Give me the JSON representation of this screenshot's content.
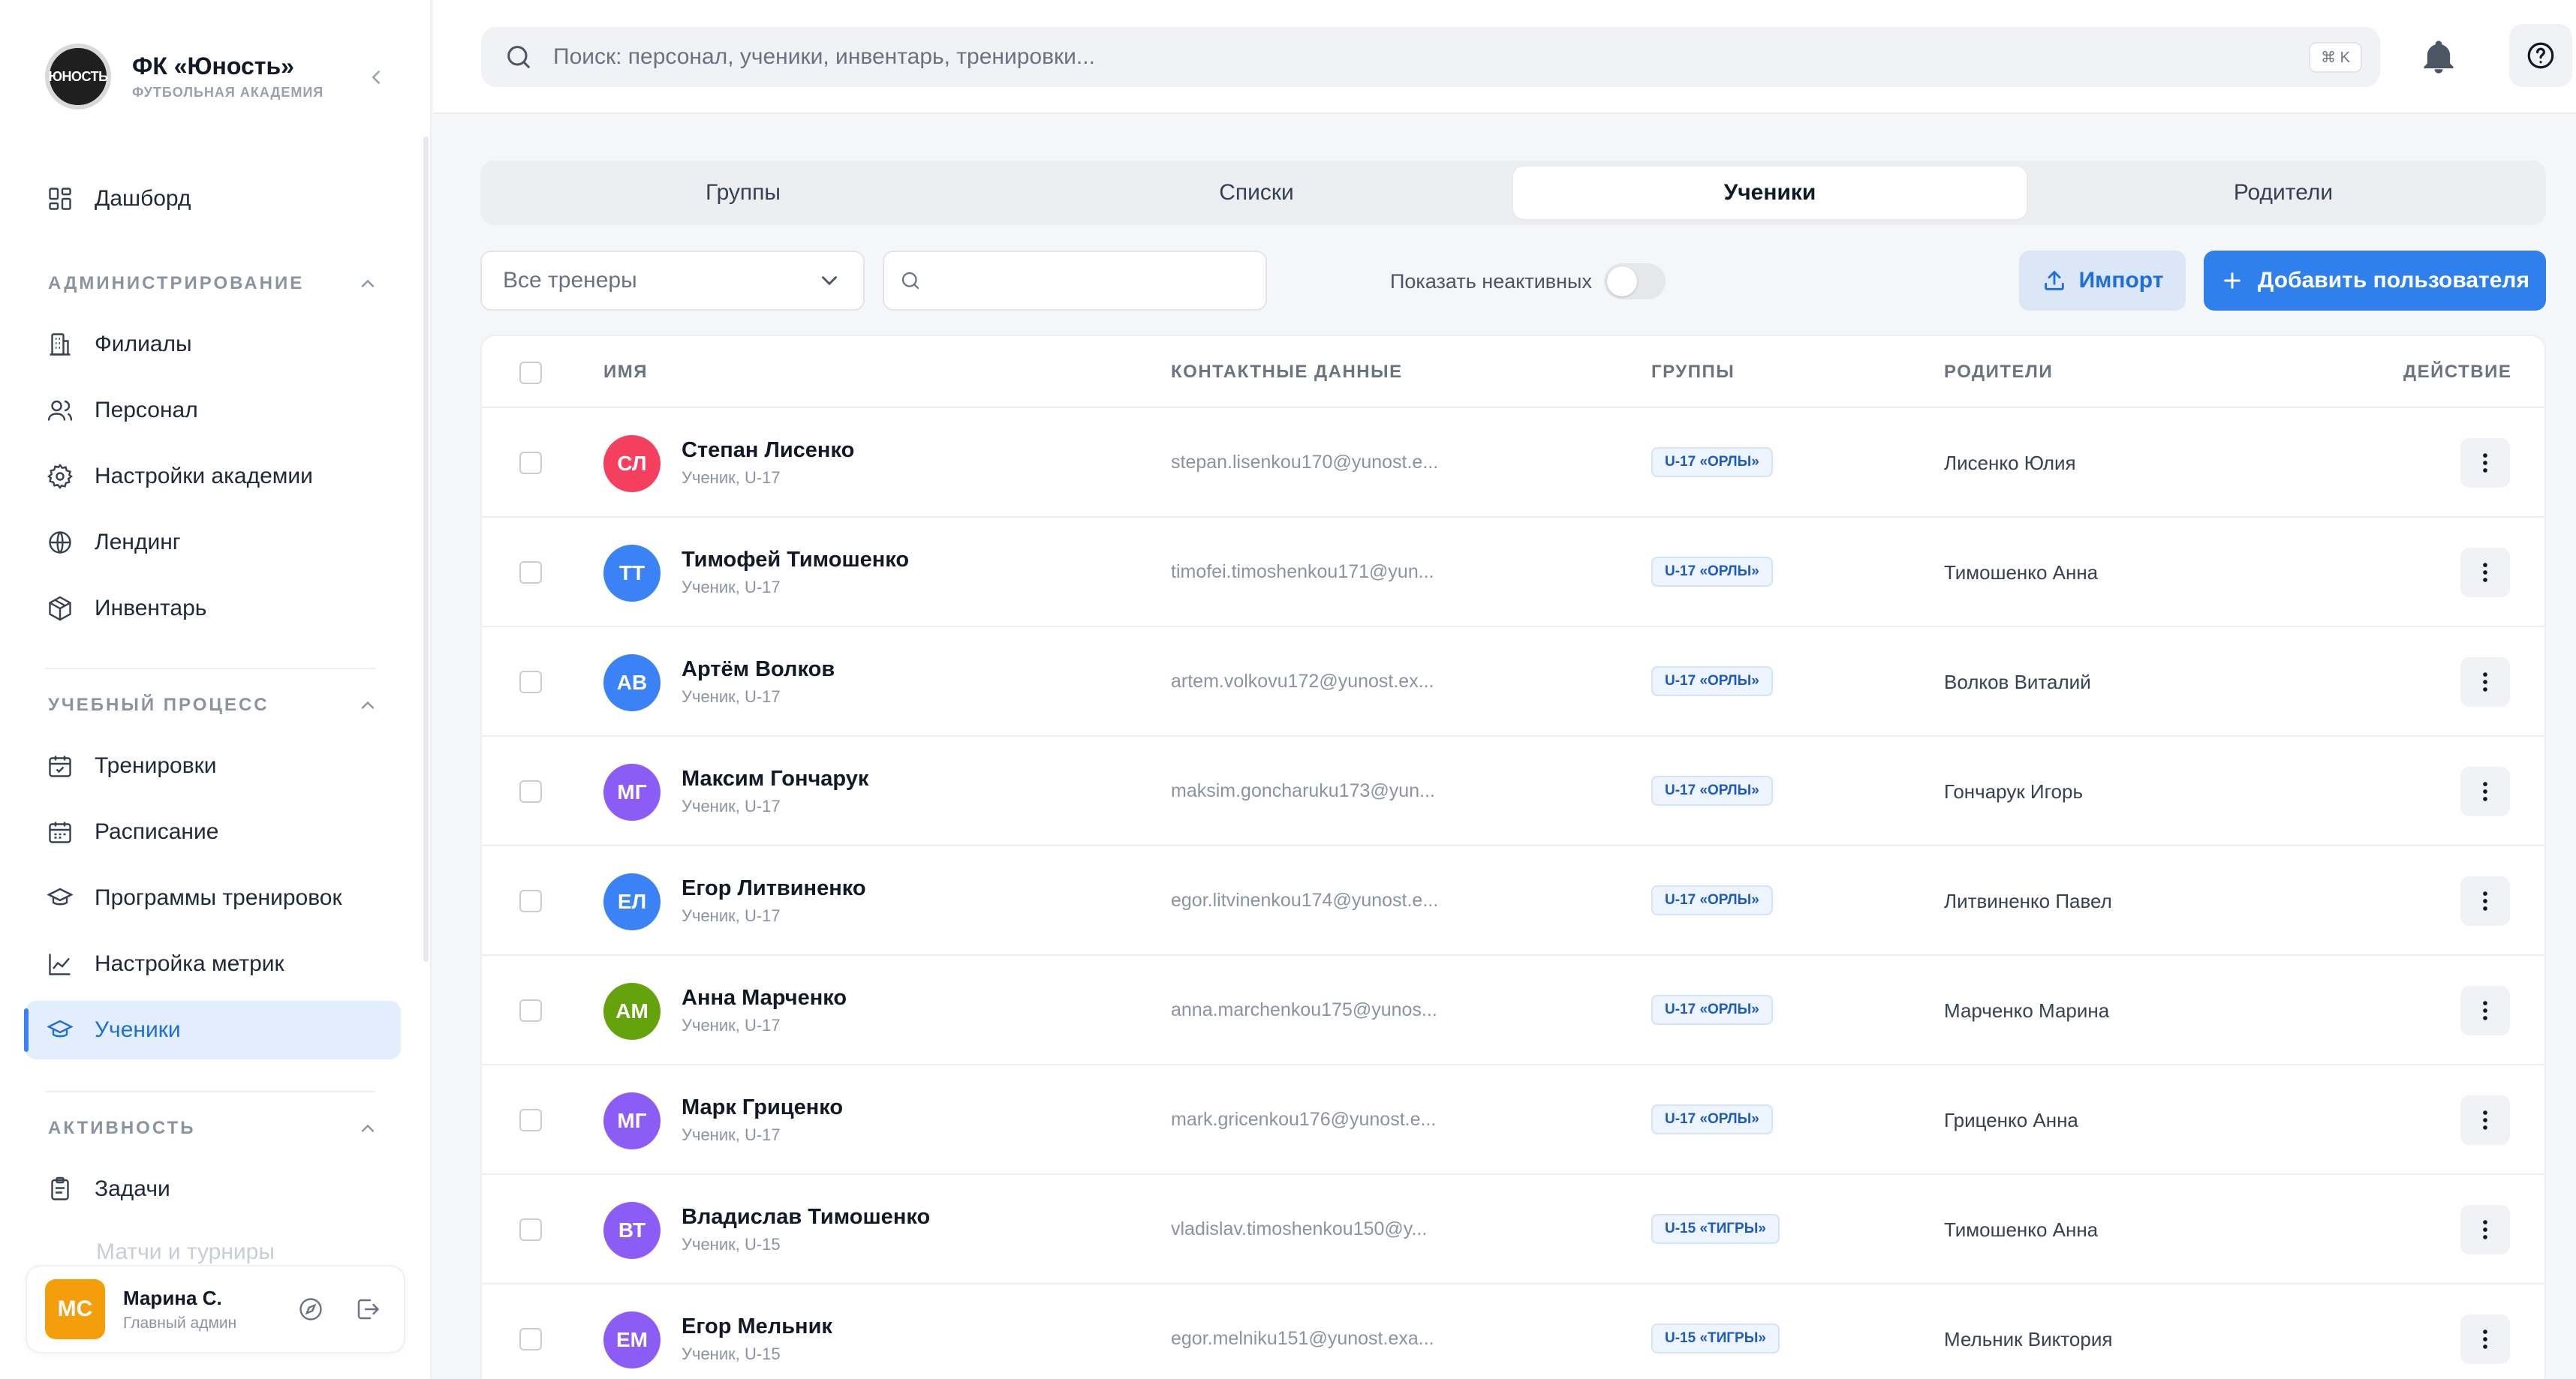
{
  "brand": {
    "name": "ФК «Юность»",
    "subtitle": "ФУТБОЛЬНАЯ АКАДЕМИЯ",
    "logo_text": "ЮНОСТЬ"
  },
  "sidebar": {
    "top_items": [
      {
        "label": "Дашборд",
        "icon": "dashboard-icon"
      }
    ],
    "sections": [
      {
        "title": "АДМИНИСТРИРОВАНИЕ",
        "items": [
          {
            "label": "Филиалы",
            "icon": "building-icon"
          },
          {
            "label": "Персонал",
            "icon": "users-icon"
          },
          {
            "label": "Настройки академии",
            "icon": "gear-icon"
          },
          {
            "label": "Лендинг",
            "icon": "globe-icon"
          },
          {
            "label": "Инвентарь",
            "icon": "box-icon"
          }
        ]
      },
      {
        "title": "УЧЕБНЫЙ ПРОЦЕСС",
        "items": [
          {
            "label": "Тренировки",
            "icon": "calendar-check-icon"
          },
          {
            "label": "Расписание",
            "icon": "calendar-icon"
          },
          {
            "label": "Программы тренировок",
            "icon": "graduation-cap-icon"
          },
          {
            "label": "Настройка метрик",
            "icon": "chart-line-icon"
          },
          {
            "label": "Ученики",
            "icon": "graduation-cap-icon",
            "active": true
          }
        ]
      },
      {
        "title": "АКТИВНОСТЬ",
        "items": [
          {
            "label": "Задачи",
            "icon": "clipboard-icon"
          },
          {
            "label": "Матчи и турниры",
            "icon": "trophy-icon",
            "faded": true
          }
        ]
      }
    ],
    "user": {
      "initials": "МС",
      "name": "Марина С.",
      "role": "Главный админ"
    }
  },
  "topbar": {
    "search_placeholder": "Поиск: персонал, ученики, инвентарь, тренировки...",
    "shortcut": "⌘ K"
  },
  "tabs": [
    {
      "label": "Группы"
    },
    {
      "label": "Списки"
    },
    {
      "label": "Ученики",
      "active": true
    },
    {
      "label": "Родители"
    }
  ],
  "toolbar": {
    "trainer_select": "Все тренеры",
    "filter_placeholder": "",
    "show_inactive_label": "Показать неактивных",
    "show_inactive": false,
    "import_label": "Импорт",
    "add_label": "Добавить пользователя"
  },
  "table": {
    "columns": {
      "name": "ИМЯ",
      "contacts": "КОНТАКТНЫЕ ДАННЫЕ",
      "groups": "ГРУППЫ",
      "parents": "РОДИТЕЛИ",
      "action": "ДЕЙСТВИЕ"
    },
    "rows": [
      {
        "initials": "СЛ",
        "color": "#f43f5e",
        "name": "Степан Лисенко",
        "sub": "Ученик, U-17",
        "email": "stepan.lisenkou170@yunost.e...",
        "group": "U-17 «ОРЛЫ»",
        "parent": "Лисенко Юлия"
      },
      {
        "initials": "ТТ",
        "color": "#3b82f6",
        "name": "Тимофей Тимошенко",
        "sub": "Ученик, U-17",
        "email": "timofei.timoshenkou171@yun...",
        "group": "U-17 «ОРЛЫ»",
        "parent": "Тимошенко Анна"
      },
      {
        "initials": "АВ",
        "color": "#3b82f6",
        "name": "Артём Волков",
        "sub": "Ученик, U-17",
        "email": "artem.volkovu172@yunost.ex...",
        "group": "U-17 «ОРЛЫ»",
        "parent": "Волков Виталий"
      },
      {
        "initials": "МГ",
        "color": "#8b5cf6",
        "name": "Максим Гончарук",
        "sub": "Ученик, U-17",
        "email": "maksim.goncharuku173@yun...",
        "group": "U-17 «ОРЛЫ»",
        "parent": "Гончарук Игорь"
      },
      {
        "initials": "ЕЛ",
        "color": "#3b82f6",
        "name": "Егор Литвиненко",
        "sub": "Ученик, U-17",
        "email": "egor.litvinenkou174@yunost.e...",
        "group": "U-17 «ОРЛЫ»",
        "parent": "Литвиненко Павел"
      },
      {
        "initials": "АМ",
        "color": "#65a30d",
        "name": "Анна Марченко",
        "sub": "Ученик, U-17",
        "email": "anna.marchenkou175@yunos...",
        "group": "U-17 «ОРЛЫ»",
        "parent": "Марченко Марина"
      },
      {
        "initials": "МГ",
        "color": "#8b5cf6",
        "name": "Марк Гриценко",
        "sub": "Ученик, U-17",
        "email": "mark.gricenkou176@yunost.e...",
        "group": "U-17 «ОРЛЫ»",
        "parent": "Гриценко Анна"
      },
      {
        "initials": "ВТ",
        "color": "#8b5cf6",
        "name": "Владислав Тимошенко",
        "sub": "Ученик, U-15",
        "email": "vladislav.timoshenkou150@y...",
        "group": "U-15 «ТИГРЫ»",
        "parent": "Тимошенко Анна"
      },
      {
        "initials": "ЕМ",
        "color": "#8b5cf6",
        "name": "Егор Мельник",
        "sub": "Ученик, U-15",
        "email": "egor.melniku151@yunost.exa...",
        "group": "U-15 «ТИГРЫ»",
        "parent": "Мельник Виктория"
      }
    ]
  }
}
